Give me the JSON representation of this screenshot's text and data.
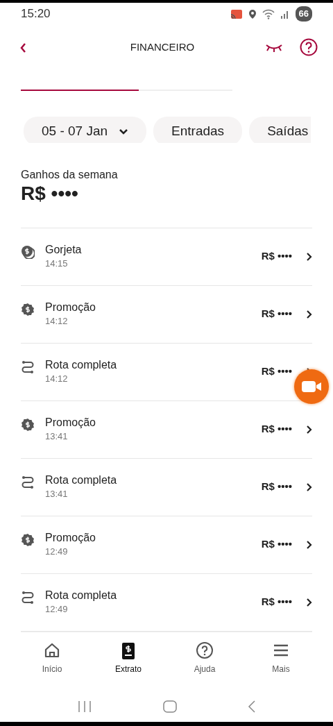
{
  "status_bar": {
    "time": "15:20",
    "battery": "66"
  },
  "header": {
    "title": "FINANCEIRO"
  },
  "tabs": [
    {
      "selected": true
    },
    {
      "selected": false
    }
  ],
  "filters": [
    {
      "kind": "dropdown",
      "label": "05 - 07 Jan"
    },
    {
      "kind": "chip",
      "label": "Entradas"
    },
    {
      "kind": "chip",
      "label": "Saídas"
    }
  ],
  "summary": {
    "label": "Ganhos da semana",
    "amount": "R$ ••••"
  },
  "transactions": [
    {
      "kind": "tip",
      "title": "Gorjeta",
      "time": "14:15",
      "amount": "R$ ••••"
    },
    {
      "kind": "promo",
      "title": "Promoção",
      "time": "14:12",
      "amount": "R$ ••••"
    },
    {
      "kind": "route",
      "title": "Rota completa",
      "time": "14:12",
      "amount": "R$ ••••"
    },
    {
      "kind": "promo",
      "title": "Promoção",
      "time": "13:41",
      "amount": "R$ ••••"
    },
    {
      "kind": "route",
      "title": "Rota completa",
      "time": "13:41",
      "amount": "R$ ••••"
    },
    {
      "kind": "promo",
      "title": "Promoção",
      "time": "12:49",
      "amount": "R$ ••••"
    },
    {
      "kind": "route",
      "title": "Rota completa",
      "time": "12:49",
      "amount": "R$ ••••"
    }
  ],
  "bottom_nav": [
    {
      "label": "Início",
      "selected": false
    },
    {
      "label": "Extrato",
      "selected": true
    },
    {
      "label": "Ajuda",
      "selected": false
    },
    {
      "label": "Mais",
      "selected": false
    }
  ]
}
